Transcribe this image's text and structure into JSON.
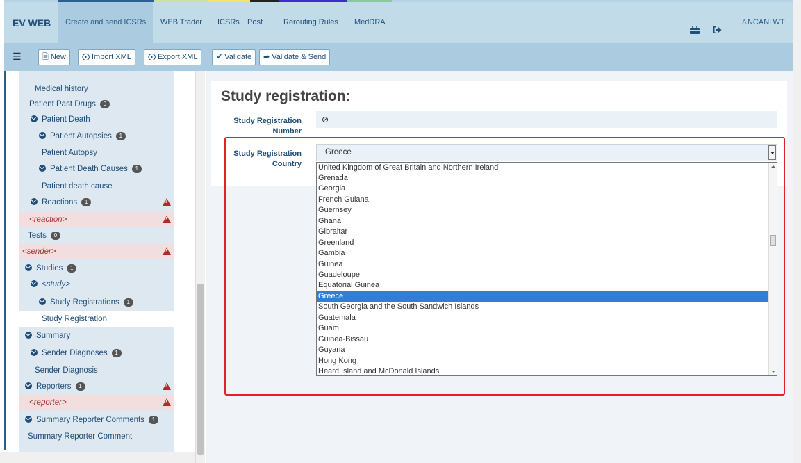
{
  "navbar": {
    "brand": "EV WEB",
    "tabs": [
      {
        "label": "Create and send ICSRs"
      },
      {
        "label": "WEB Trader"
      },
      {
        "label": "ICSRs"
      },
      {
        "label": "Post"
      },
      {
        "label": "Rerouting Rules"
      },
      {
        "label": "MedDRA"
      }
    ],
    "user": "NCANLWT",
    "accent_colors": [
      "#2d5f8c",
      "#c9e0a6",
      "#f5e26a",
      "#222222",
      "#3a2fc9",
      "#8cc7a0"
    ]
  },
  "toolbar": {
    "new_label": "New",
    "import_label": "Import XML",
    "export_label": "Export XML",
    "validate_label": "Validate",
    "validate_send_label": "Validate & Send"
  },
  "sidebar": {
    "items": [
      {
        "label": "Medical history"
      },
      {
        "label": "Patient Past Drugs",
        "badge": "0"
      },
      {
        "label": "Patient Death"
      },
      {
        "label": "Patient Autopsies",
        "badge": "1"
      },
      {
        "label": "Patient Autopsy"
      },
      {
        "label": "Patient Death Causes",
        "badge": "1"
      },
      {
        "label": "Patient death cause"
      },
      {
        "label": "Reactions",
        "badge": "1"
      },
      {
        "label": "<reaction>"
      },
      {
        "label": "Tests",
        "badge": "0"
      },
      {
        "label": "<sender>"
      },
      {
        "label": "Studies",
        "badge": "1"
      },
      {
        "label": "<study>"
      },
      {
        "label": "Study Registrations",
        "badge": "1"
      },
      {
        "label": "Study Registration"
      },
      {
        "label": "Summary"
      },
      {
        "label": "Sender Diagnoses",
        "badge": "1"
      },
      {
        "label": "Sender Diagnosis"
      },
      {
        "label": "Reporters",
        "badge": "1"
      },
      {
        "label": "<reporter>"
      },
      {
        "label": "Summary Reporter Comments",
        "badge": "1"
      },
      {
        "label": "Summary Reporter Comment"
      }
    ]
  },
  "main": {
    "title": "Study registration:",
    "number_label_1": "Study Registration",
    "number_label_2": "Number",
    "number_value": "⊘",
    "country_label_1": "Study Registration",
    "country_label_2": "Country",
    "country_value": "Greece",
    "country_options": [
      "United Kingdom of Great Britain and Northern Ireland",
      "Grenada",
      "Georgia",
      "French Guiana",
      "Guernsey",
      "Ghana",
      "Gibraltar",
      "Greenland",
      "Gambia",
      "Guinea",
      "Guadeloupe",
      "Equatorial Guinea",
      "Greece",
      "South Georgia and the South Sandwich Islands",
      "Guatemala",
      "Guam",
      "Guinea-Bissau",
      "Guyana",
      "Hong Kong",
      "Heard Island and McDonald Islands"
    ]
  }
}
